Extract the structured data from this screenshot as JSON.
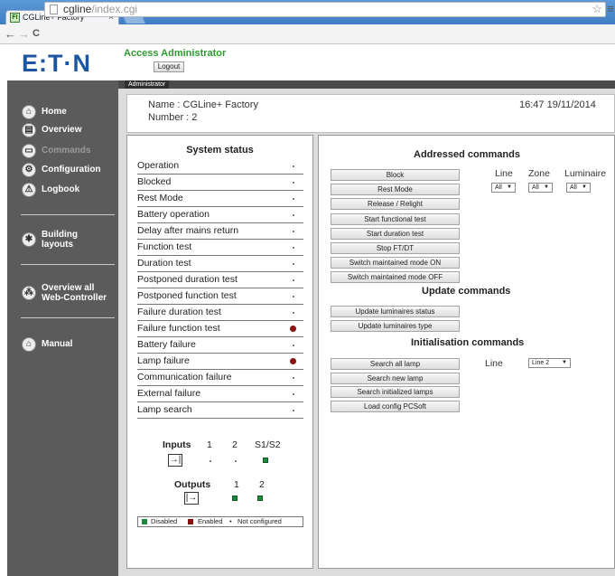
{
  "browser": {
    "tab_title": "CGLine+ Factory",
    "tab_close": "×",
    "favicon_text": "FI",
    "url_host": "cgline",
    "url_path": "/index.cgi",
    "window_controls": "– ▫ ×",
    "nav_back": "←",
    "nav_forward": "→",
    "nav_reload": "C",
    "star": "☆",
    "menu": "≡"
  },
  "header": {
    "logo": "E:T·N",
    "access_title": "Access Administrator",
    "logout_label": "Logout",
    "admin_tab": "Administrator"
  },
  "sidebar": {
    "items": [
      {
        "label": "Home",
        "icon": "home-icon",
        "glyph": "⌂"
      },
      {
        "label": "Overview",
        "icon": "overview-icon",
        "glyph": "▤"
      },
      {
        "label": "Commands",
        "icon": "commands-icon",
        "glyph": "▭"
      },
      {
        "label": "Configuration",
        "icon": "configuration-icon",
        "glyph": "⚙"
      },
      {
        "label": "Logbook",
        "icon": "logbook-icon",
        "glyph": "⚠"
      },
      {
        "label": "Building layouts",
        "line1": "Building",
        "line2": "layouts",
        "icon": "building-layouts-icon",
        "glyph": "✱"
      },
      {
        "label": "Overview all Web-Controller",
        "line1": "Overview all",
        "line2": "Web-Controller",
        "icon": "web-controller-icon",
        "glyph": "⁂"
      },
      {
        "label": "Manual",
        "icon": "manual-icon",
        "glyph": "⌂"
      }
    ]
  },
  "info": {
    "name": "Name : CGLine+ Factory",
    "number": "Number : 2",
    "datetime": "16:47 19/11/2014"
  },
  "system_status": {
    "title": "System status",
    "rows": [
      {
        "label": "Operation",
        "state": "not-configured"
      },
      {
        "label": "Blocked",
        "state": "not-configured"
      },
      {
        "label": "Rest Mode",
        "state": "not-configured"
      },
      {
        "label": "Battery operation",
        "state": "not-configured"
      },
      {
        "label": "Delay after mains return",
        "state": "not-configured"
      },
      {
        "label": "Function test",
        "state": "not-configured"
      },
      {
        "label": "Duration test",
        "state": "not-configured"
      },
      {
        "label": "Postponed duration test",
        "state": "not-configured"
      },
      {
        "label": "Postponed function test",
        "state": "not-configured"
      },
      {
        "label": "Failure duration test",
        "state": "not-configured"
      },
      {
        "label": "Failure function test",
        "state": "enabled"
      },
      {
        "label": "Battery failure",
        "state": "not-configured"
      },
      {
        "label": "Lamp failure",
        "state": "enabled"
      },
      {
        "label": "Communication failure",
        "state": "not-configured"
      },
      {
        "label": "External failure",
        "state": "not-configured"
      },
      {
        "label": "Lamp search",
        "state": "not-configured"
      }
    ],
    "inputs_label": "Inputs",
    "input_cols": [
      "1",
      "2",
      "S1/S2"
    ],
    "input_states": [
      "not-configured",
      "not-configured",
      "disabled"
    ],
    "outputs_label": "Outputs",
    "output_cols": [
      "1",
      "2"
    ],
    "output_states": [
      "disabled",
      "disabled"
    ],
    "input_icon_glyph": "→|",
    "output_icon_glyph": "|→",
    "legend": {
      "disabled": "Disabled",
      "enabled": "Enabled",
      "not_configured": "Not configured",
      "dot": "•"
    }
  },
  "commands": {
    "addressed_title": "Addressed commands",
    "addressed_buttons": [
      "Block",
      "Rest Mode",
      "Release / Relight",
      "Start functional test",
      "Start duration test",
      "Stop FT/DT",
      "Switch maintained mode ON",
      "Switch maintained mode OFF"
    ],
    "line_label": "Line",
    "zone_label": "Zone",
    "luminaire_label": "Luminaire",
    "line_value": "All",
    "zone_value": "All",
    "luminaire_value": "All",
    "update_title": "Update commands",
    "update_buttons": [
      "Update luminaires status",
      "Update luminaires type"
    ],
    "init_title": "Initialisation commands",
    "init_buttons": [
      "Search all lamp",
      "Search new lamp",
      "Search initialized lamps",
      "Load config PCSoft"
    ],
    "init_line_label": "Line",
    "init_line_value": "Line 2",
    "dropdown_arrow": "▼"
  },
  "colors": {
    "enabled": "#8b1010",
    "disabled": "#1b8a3a",
    "accent_green": "#2e9a2e",
    "brand_blue": "#1c56a2",
    "sidebar_bg": "#5b5b5b"
  }
}
